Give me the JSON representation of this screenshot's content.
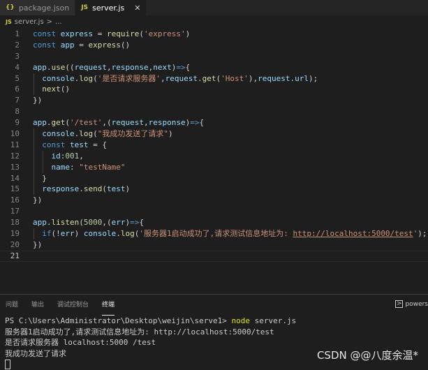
{
  "tabs": [
    {
      "icon": "{}",
      "label": "package.json"
    },
    {
      "icon": "JS",
      "label": "server.js",
      "close": "✕"
    }
  ],
  "breadcrumb": {
    "icon": "JS",
    "file": "server.js",
    "sep": ">",
    "rest": "..."
  },
  "code": {
    "line_numbers": [
      "1",
      "2",
      "3",
      "4",
      "5",
      "6",
      "7",
      "8",
      "9",
      "10",
      "11",
      "12",
      "13",
      "14",
      "15",
      "16",
      "17",
      "18",
      "19",
      "20",
      "21"
    ],
    "current_line": 21
  },
  "panel": {
    "tabs": [
      "问题",
      "输出",
      "调试控制台",
      "终端"
    ],
    "active_tab": "终端",
    "terminal_selector": "powers",
    "terminal_lines": [
      {
        "prompt": "PS C:\\Users\\Administrator\\Desktop\\weijin\\serve1> ",
        "cmd": "node",
        "args": " server.js"
      },
      {
        "text": "服务器1启动成功了,请求测试信息地址为: http://localhost:5000/test"
      },
      {
        "text": "是否请求服务器 localhost:5000 /test"
      },
      {
        "text": "我成功发送了请求"
      }
    ]
  },
  "watermark": "CSDN @@八度余温*"
}
